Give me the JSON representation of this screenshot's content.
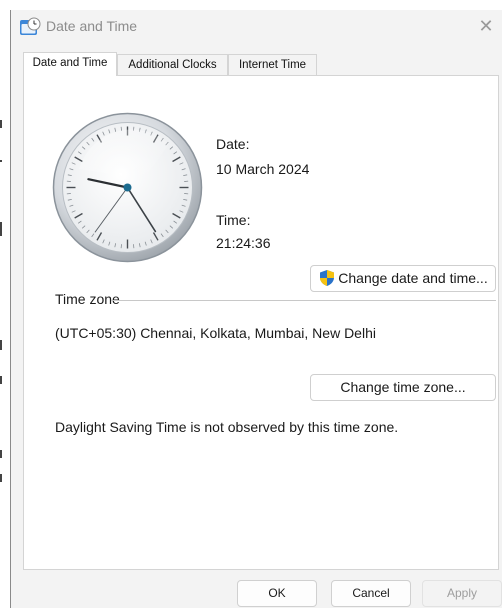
{
  "window": {
    "title": "Date and Time",
    "close_glyph": "✕",
    "title_icon": "date-time-icon"
  },
  "tabs": [
    {
      "label": "Date and Time",
      "active": true
    },
    {
      "label": "Additional Clocks",
      "active": false
    },
    {
      "label": "Internet Time",
      "active": false
    }
  ],
  "date_time": {
    "date_label": "Date:",
    "date_value": "10 March 2024",
    "time_label": "Time:",
    "time_value": "21:24:36",
    "clock_time": {
      "hour": 21,
      "minute": 24,
      "second": 36
    },
    "change_datetime_button": "Change date and time..."
  },
  "time_zone": {
    "section_label": "Time zone",
    "value": "(UTC+05:30) Chennai, Kolkata, Mumbai, New Delhi",
    "change_button": "Change time zone...",
    "dst_note": "Daylight Saving Time is not observed by this time zone."
  },
  "footer": {
    "ok": "OK",
    "cancel": "Cancel",
    "apply": "Apply",
    "apply_enabled": false
  },
  "colors": {
    "accent": "#0067c0",
    "window_bg": "#f3f3f3",
    "panel_bg": "#ffffff",
    "disabled_text": "#9d9d9d"
  }
}
